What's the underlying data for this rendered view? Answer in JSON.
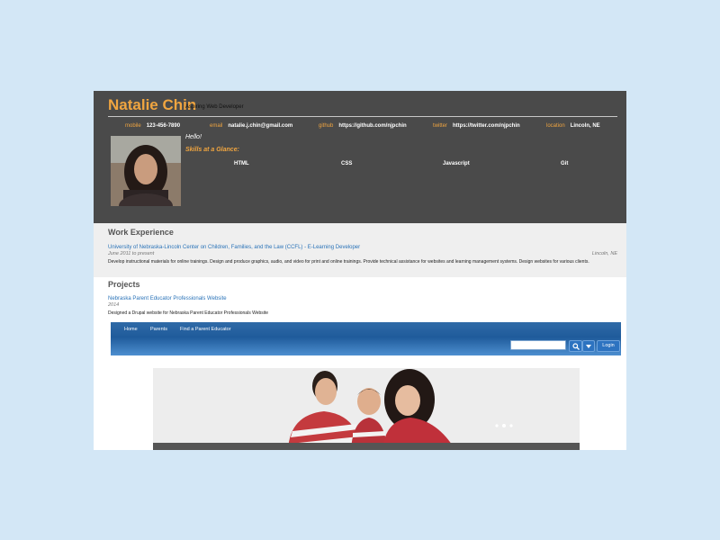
{
  "header": {
    "name": "Natalie Chin",
    "tagline": "Aspiring Web Developer",
    "contacts": [
      {
        "key": "mobile",
        "value": "123-456-7890"
      },
      {
        "key": "email",
        "value": "natalie.j.chin@gmail.com"
      },
      {
        "key": "github",
        "value": "https://github.com/njpchin"
      },
      {
        "key": "twitter",
        "value": "https://twitter.com/njpchin"
      },
      {
        "key": "location",
        "value": "Lincoln, NE"
      }
    ],
    "greeting": "Hello!",
    "skills_title": "Skills at a Glance:",
    "skills": [
      "HTML",
      "CSS",
      "Javascript",
      "Git"
    ]
  },
  "work": {
    "title": "Work Experience",
    "jobs": [
      {
        "employer_title": "University of Nebraska-Lincoln Center on Children, Families, and the Law (CCFL) - E-Learning Developer",
        "dates": "June 2011 to present",
        "location": "Lincoln, NE",
        "description": "Develop instructional materials for online trainings. Design and produce graphics, audio, and video for print and online trainings. Provide technical assistance for websites and learning management systems. Design websites for various clients."
      }
    ]
  },
  "projects": {
    "title": "Projects",
    "items": [
      {
        "name": "Nebraska Parent Educator Professionals Website",
        "year": "2014",
        "description": "Designed a Drupal website for Nebraska Parent Educator Professionals Website"
      }
    ]
  },
  "embedded_site": {
    "nav": [
      "Home",
      "Parents",
      "Find a Parent Educator"
    ],
    "login_label": "Login"
  },
  "colors": {
    "accent": "#f0a540",
    "header_bg": "#4a4a4a",
    "link": "#2a73b8",
    "site_nav": "#1f5b9b"
  }
}
